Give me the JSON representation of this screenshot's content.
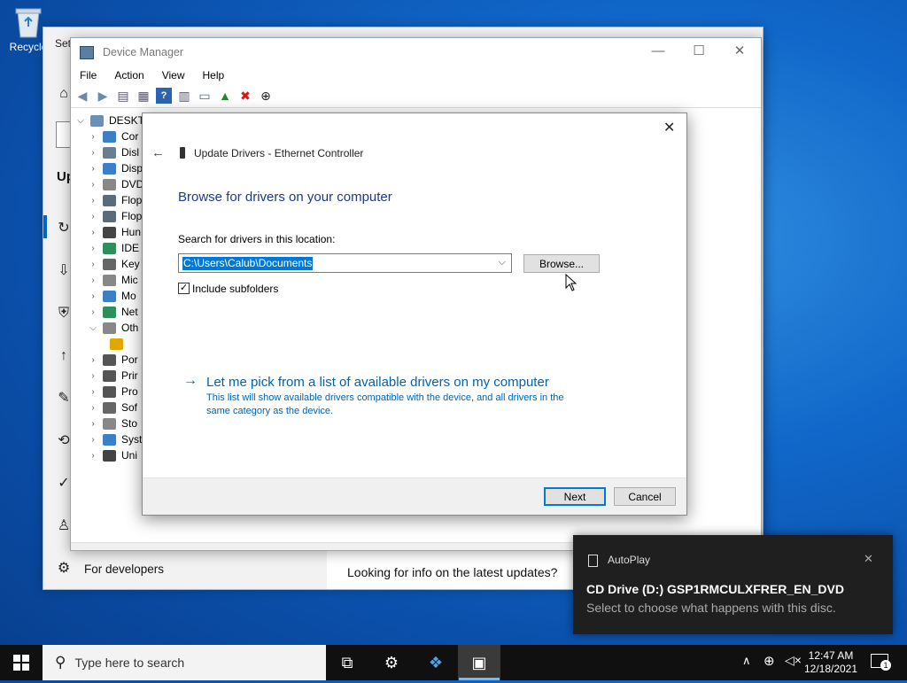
{
  "desktop": {
    "recycle_bin_label": "Recycle"
  },
  "settings_window": {
    "title_fragment": "Set",
    "heading_fragment": "Up",
    "for_developers": "For developers",
    "latest_updates": "Looking for info on the latest updates?"
  },
  "device_manager": {
    "title": "Device Manager",
    "menu": [
      "File",
      "Action",
      "View",
      "Help"
    ],
    "tree_root": "DESKTO",
    "tree_items": [
      "Cor",
      "Disl",
      "Disp",
      "DVD",
      "Flop",
      "Flop",
      "Hun",
      "IDE",
      "Key",
      "Mic",
      "Mo",
      "Net",
      "Oth",
      "",
      "Por",
      "Prir",
      "Pro",
      "Sof",
      "Sto",
      "Syst",
      "Uni"
    ]
  },
  "dialog": {
    "title": "Update Drivers - Ethernet Controller",
    "heading": "Browse for drivers on your computer",
    "search_label": "Search for drivers in this location:",
    "path_value": "C:\\Users\\Calub\\Documents",
    "browse_button": "Browse...",
    "include_subfolders": "Include subfolders",
    "include_subfolders_checked": true,
    "pick_link": "Let me pick from a list of available drivers on my computer",
    "pick_desc_line1": "This list will show available drivers compatible with the device, and all drivers in the",
    "pick_desc_line2": "same category as the device.",
    "next_button": "Next",
    "cancel_button": "Cancel"
  },
  "toast": {
    "app_name": "AutoPlay",
    "title": "CD Drive (D:) GSP1RMCULXFRER_EN_DVD",
    "body": "Select to choose what happens with this disc."
  },
  "taskbar": {
    "search_placeholder": "Type here to search",
    "time": "12:47 AM",
    "date": "12/18/2021",
    "notification_count": "1"
  },
  "colors": {
    "accent": "#0078d7",
    "heading_blue": "#1e3a8a",
    "link_blue": "#0063b1",
    "taskbar": "#101010",
    "toast_bg": "#1f1f1f"
  }
}
